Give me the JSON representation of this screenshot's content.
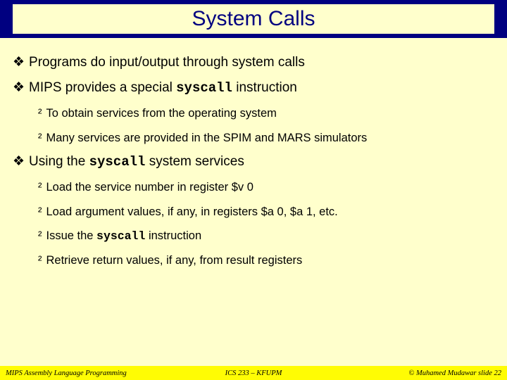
{
  "title": "System Calls",
  "bullets": {
    "b1": "Programs do input/output through system calls",
    "b2_pre": "MIPS provides a special ",
    "b2_code": "syscall",
    "b2_post": " instruction",
    "b2a": "To obtain services from the operating system",
    "b2b": "Many services are provided in the SPIM and MARS simulators",
    "b3_pre": "Using the ",
    "b3_code": "syscall",
    "b3_post": " system services",
    "b3a": "Load the service number in register $v 0",
    "b3b": "Load argument values, if any, in registers $a 0, $a 1, etc.",
    "b3c_pre": "Issue the ",
    "b3c_code": "syscall",
    "b3c_post": " instruction",
    "b3d": "Retrieve return values, if any, from result registers"
  },
  "footer": {
    "left": "MIPS Assembly Language Programming",
    "center": "ICS 233 – KFUPM",
    "right": "© Muhamed Mudawar   slide 22"
  },
  "markers": {
    "l1": "❖",
    "l2": "²"
  }
}
